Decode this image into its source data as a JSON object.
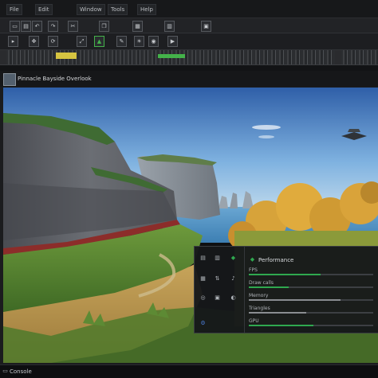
{
  "menubar": {
    "items": [
      "File",
      "Edit",
      "Window",
      "Tools",
      "Help"
    ]
  },
  "toolbar1": {
    "icons": [
      "save-icon",
      "open-icon",
      "undo-icon",
      "redo-icon",
      "cut-icon",
      "copy-icon",
      "paste-icon",
      "grid-icon",
      "snap-icon"
    ]
  },
  "toolbar2": {
    "icons": [
      "select-icon",
      "move-icon",
      "rotate-icon",
      "scale-icon",
      "terrain-icon",
      "paint-icon",
      "light-icon",
      "camera-icon",
      "play-icon"
    ]
  },
  "ticker": {
    "label_left": "",
    "label_right": ""
  },
  "viewport": {
    "title": "Pinnacle Bayside Overlook"
  },
  "overlay": {
    "title": "Performance",
    "stats": [
      {
        "label": "FPS",
        "value": 0.58,
        "color": "#2fa84f"
      },
      {
        "label": "Draw calls",
        "value": 0.32,
        "color": "#2fa84f"
      },
      {
        "label": "Memory",
        "value": 0.74,
        "color": "#8a8d91"
      },
      {
        "label": "Triangles",
        "value": 0.46,
        "color": "#8a8d91"
      },
      {
        "label": "GPU",
        "value": 0.52,
        "color": "#2fa84f"
      }
    ]
  },
  "bottom": {
    "label": "Console"
  },
  "colors": {
    "accent_green": "#2fa84f",
    "ticker_yellow": "#d6c441",
    "ticker_green": "#44b24a"
  }
}
